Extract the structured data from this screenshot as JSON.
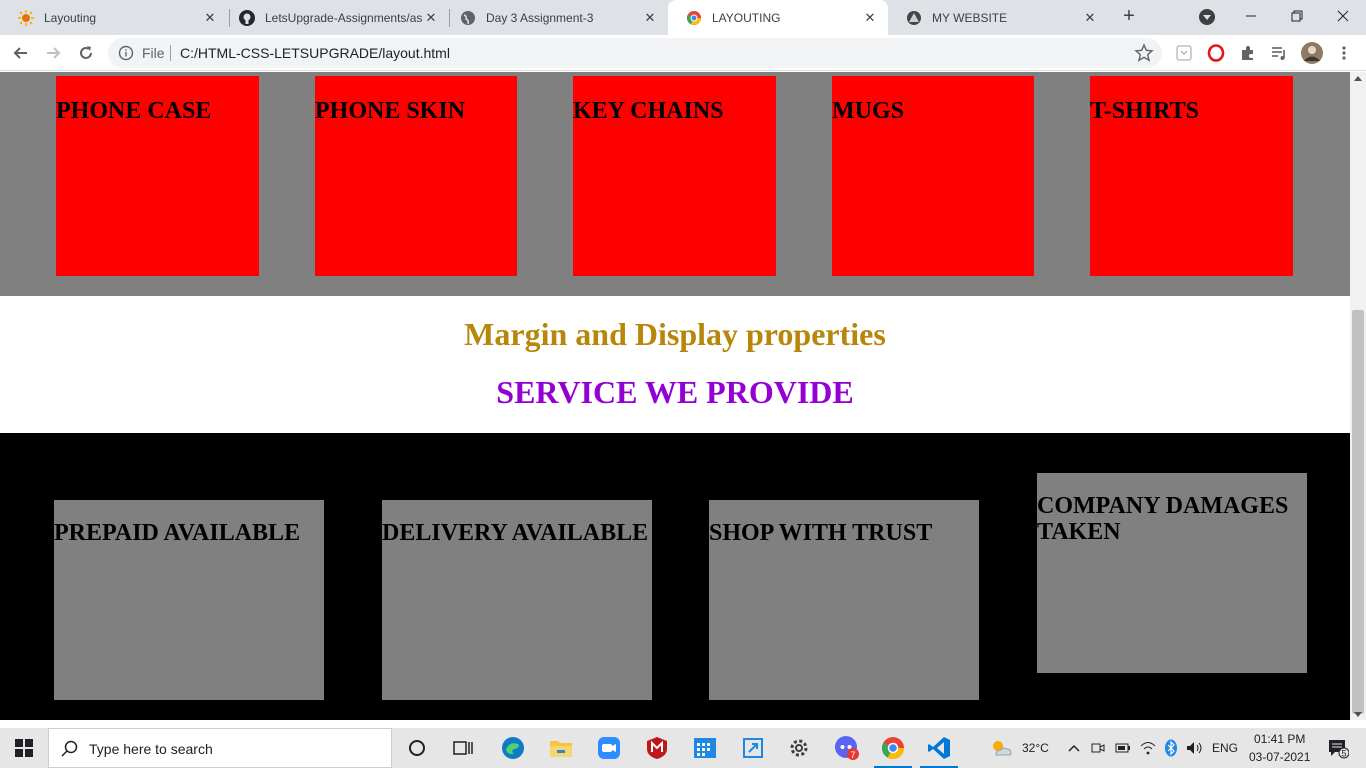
{
  "tabs": [
    {
      "title": "Layouting",
      "icon": "sun-favicon-icon",
      "active": false
    },
    {
      "title": "LetsUpgrade-Assignments/as",
      "icon": "github-icon",
      "active": false
    },
    {
      "title": "Day 3 Assignment-3",
      "icon": "globe-icon",
      "active": false
    },
    {
      "title": "LAYOUTING",
      "icon": "chrome-file-icon",
      "active": true
    },
    {
      "title": "MY WEBSITE",
      "icon": "site-logo-icon",
      "active": false
    }
  ],
  "toolbar": {
    "file_label": "File",
    "url": "C:/HTML-CSS-LETSUPGRADE/layout.html"
  },
  "page": {
    "products": [
      "PHONE CASE",
      "PHONE SKIN",
      "KEY CHAINS",
      "MUGS",
      "T-SHIRTS"
    ],
    "heading_gold": "Margin and Display properties",
    "heading_purple": "SERVICE WE PROVIDE",
    "services": [
      "PREPAID AVAILABLE",
      "DELIVERY AVAILABLE",
      "SHOP WITH TRUST",
      "COMPANY DAMAGES TAKEN"
    ],
    "colors": {
      "product_box": "#ff0000",
      "product_band": "#808080",
      "heading_gold": "#b8860b",
      "heading_purple": "#9400d3",
      "service_band": "#000000",
      "service_box": "#808080"
    }
  },
  "taskbar": {
    "search_placeholder": "Type here to search",
    "weather": "32°C",
    "language": "ENG",
    "time": "01:41 PM",
    "date": "03-07-2021",
    "notification_count": "5",
    "chat_badge": "7"
  }
}
